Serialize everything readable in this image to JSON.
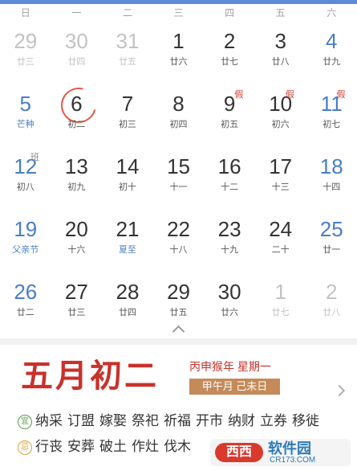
{
  "weekdays": [
    "日",
    "一",
    "二",
    "三",
    "四",
    "五",
    "六"
  ],
  "weeks": [
    [
      {
        "day": "29",
        "lunar": "廿三",
        "type": "muted"
      },
      {
        "day": "30",
        "lunar": "廿四",
        "type": "muted"
      },
      {
        "day": "31",
        "lunar": "廿五",
        "type": "muted"
      },
      {
        "day": "1",
        "lunar": "廿六",
        "type": "normal"
      },
      {
        "day": "2",
        "lunar": "廿七",
        "type": "normal"
      },
      {
        "day": "3",
        "lunar": "廿八",
        "type": "normal"
      },
      {
        "day": "4",
        "lunar": "廿九",
        "type": "weekend"
      }
    ],
    [
      {
        "day": "5",
        "lunar": "芒种",
        "type": "weekend festival"
      },
      {
        "day": "6",
        "lunar": "初二",
        "type": "today"
      },
      {
        "day": "7",
        "lunar": "初三",
        "type": "normal"
      },
      {
        "day": "8",
        "lunar": "初四",
        "type": "normal"
      },
      {
        "day": "9",
        "lunar": "初五",
        "type": "normal",
        "badge": "假",
        "badge_type": "holiday"
      },
      {
        "day": "10",
        "lunar": "初六",
        "type": "normal",
        "badge": "假",
        "badge_type": "holiday"
      },
      {
        "day": "11",
        "lunar": "初七",
        "type": "weekend",
        "badge": "假",
        "badge_type": "holiday"
      }
    ],
    [
      {
        "day": "12",
        "lunar": "初八",
        "type": "weekend",
        "badge": "班",
        "badge_type": "work"
      },
      {
        "day": "13",
        "lunar": "初九",
        "type": "normal"
      },
      {
        "day": "14",
        "lunar": "初十",
        "type": "normal"
      },
      {
        "day": "15",
        "lunar": "十一",
        "type": "normal"
      },
      {
        "day": "16",
        "lunar": "十二",
        "type": "normal"
      },
      {
        "day": "17",
        "lunar": "十三",
        "type": "normal"
      },
      {
        "day": "18",
        "lunar": "十四",
        "type": "weekend"
      }
    ],
    [
      {
        "day": "19",
        "lunar": "父亲节",
        "type": "weekend festival"
      },
      {
        "day": "20",
        "lunar": "十六",
        "type": "normal"
      },
      {
        "day": "21",
        "lunar": "夏至",
        "type": "normal festival"
      },
      {
        "day": "22",
        "lunar": "十八",
        "type": "normal"
      },
      {
        "day": "23",
        "lunar": "十九",
        "type": "normal"
      },
      {
        "day": "24",
        "lunar": "二十",
        "type": "normal"
      },
      {
        "day": "25",
        "lunar": "廿一",
        "type": "weekend"
      }
    ],
    [
      {
        "day": "26",
        "lunar": "廿二",
        "type": "weekend"
      },
      {
        "day": "27",
        "lunar": "廿三",
        "type": "normal"
      },
      {
        "day": "28",
        "lunar": "廿四",
        "type": "normal"
      },
      {
        "day": "29",
        "lunar": "廿五",
        "type": "normal"
      },
      {
        "day": "30",
        "lunar": "廿六",
        "type": "normal"
      },
      {
        "day": "1",
        "lunar": "廿七",
        "type": "muted"
      },
      {
        "day": "2",
        "lunar": "廿八",
        "type": "muted"
      }
    ]
  ],
  "detail": {
    "lunar_date": "五月初二",
    "ganzhi_year_weekday": "丙申猴年 星期一",
    "ganzhi_month_day": "甲午月 己未日",
    "yi_label": "宜",
    "yi_items": [
      "纳采",
      "订盟",
      "嫁娶",
      "祭祀",
      "祈福",
      "开市",
      "纳财",
      "立券",
      "移徙"
    ],
    "ji_label": "忌",
    "ji_items": [
      "行丧",
      "安葬",
      "破土",
      "作灶",
      "伐木"
    ]
  },
  "watermark": {
    "logo": "西西",
    "name": "软件园",
    "url": "CR173.COM"
  },
  "colors": {
    "accent": "#5b8ad6",
    "today": "#e05a48",
    "holiday": "#d6453d",
    "lunar_title": "#c9312b"
  },
  "icons": [
    "collapse-chevron-up-icon",
    "chevron-right-icon"
  ]
}
